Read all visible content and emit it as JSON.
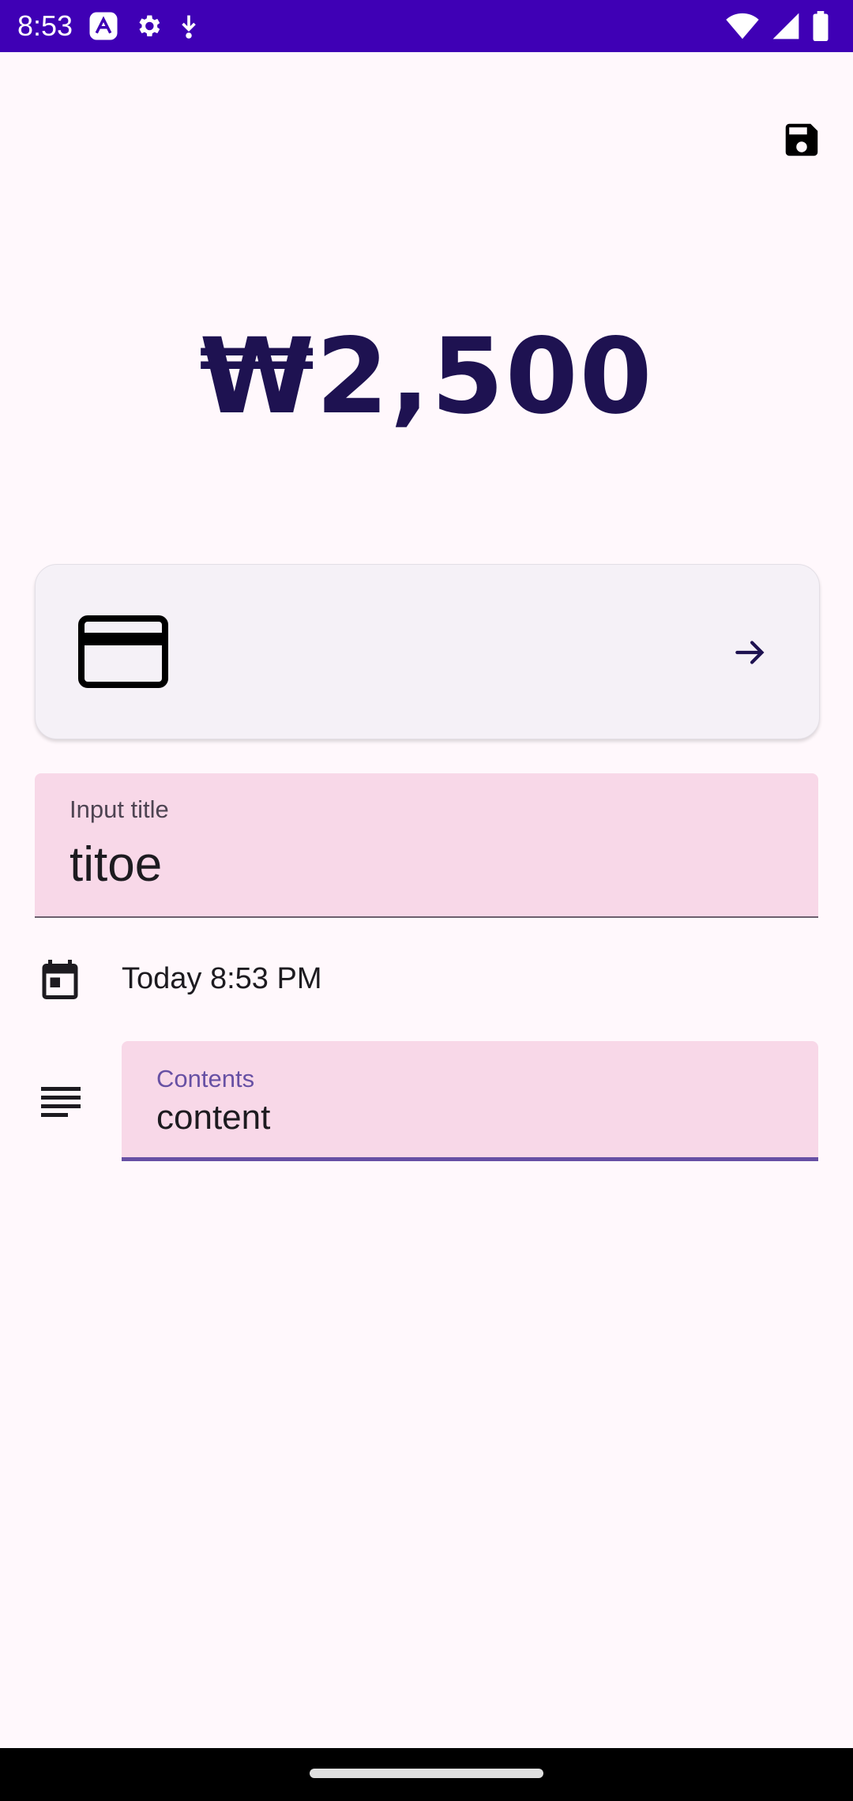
{
  "status_bar": {
    "time": "8:53",
    "left_icons": [
      "app-icon",
      "settings-icon",
      "download-icon"
    ],
    "right_icons": [
      "wifi-icon",
      "signal-icon",
      "battery-icon"
    ],
    "background": "#3F00B5"
  },
  "toolbar": {
    "save_icon": "save-icon"
  },
  "amount": {
    "display": "₩2,500",
    "color": "#1E1251"
  },
  "payment_method": {
    "card_icon": "credit-card-icon",
    "action_icon": "arrow-right-icon"
  },
  "title_field": {
    "label": "Input title",
    "value": "titoe"
  },
  "date": {
    "icon": "calendar-icon",
    "text": "Today 8:53 PM"
  },
  "contents_field": {
    "icon": "notes-icon",
    "label": "Contents",
    "value": "content",
    "accent": "#6750A4"
  }
}
